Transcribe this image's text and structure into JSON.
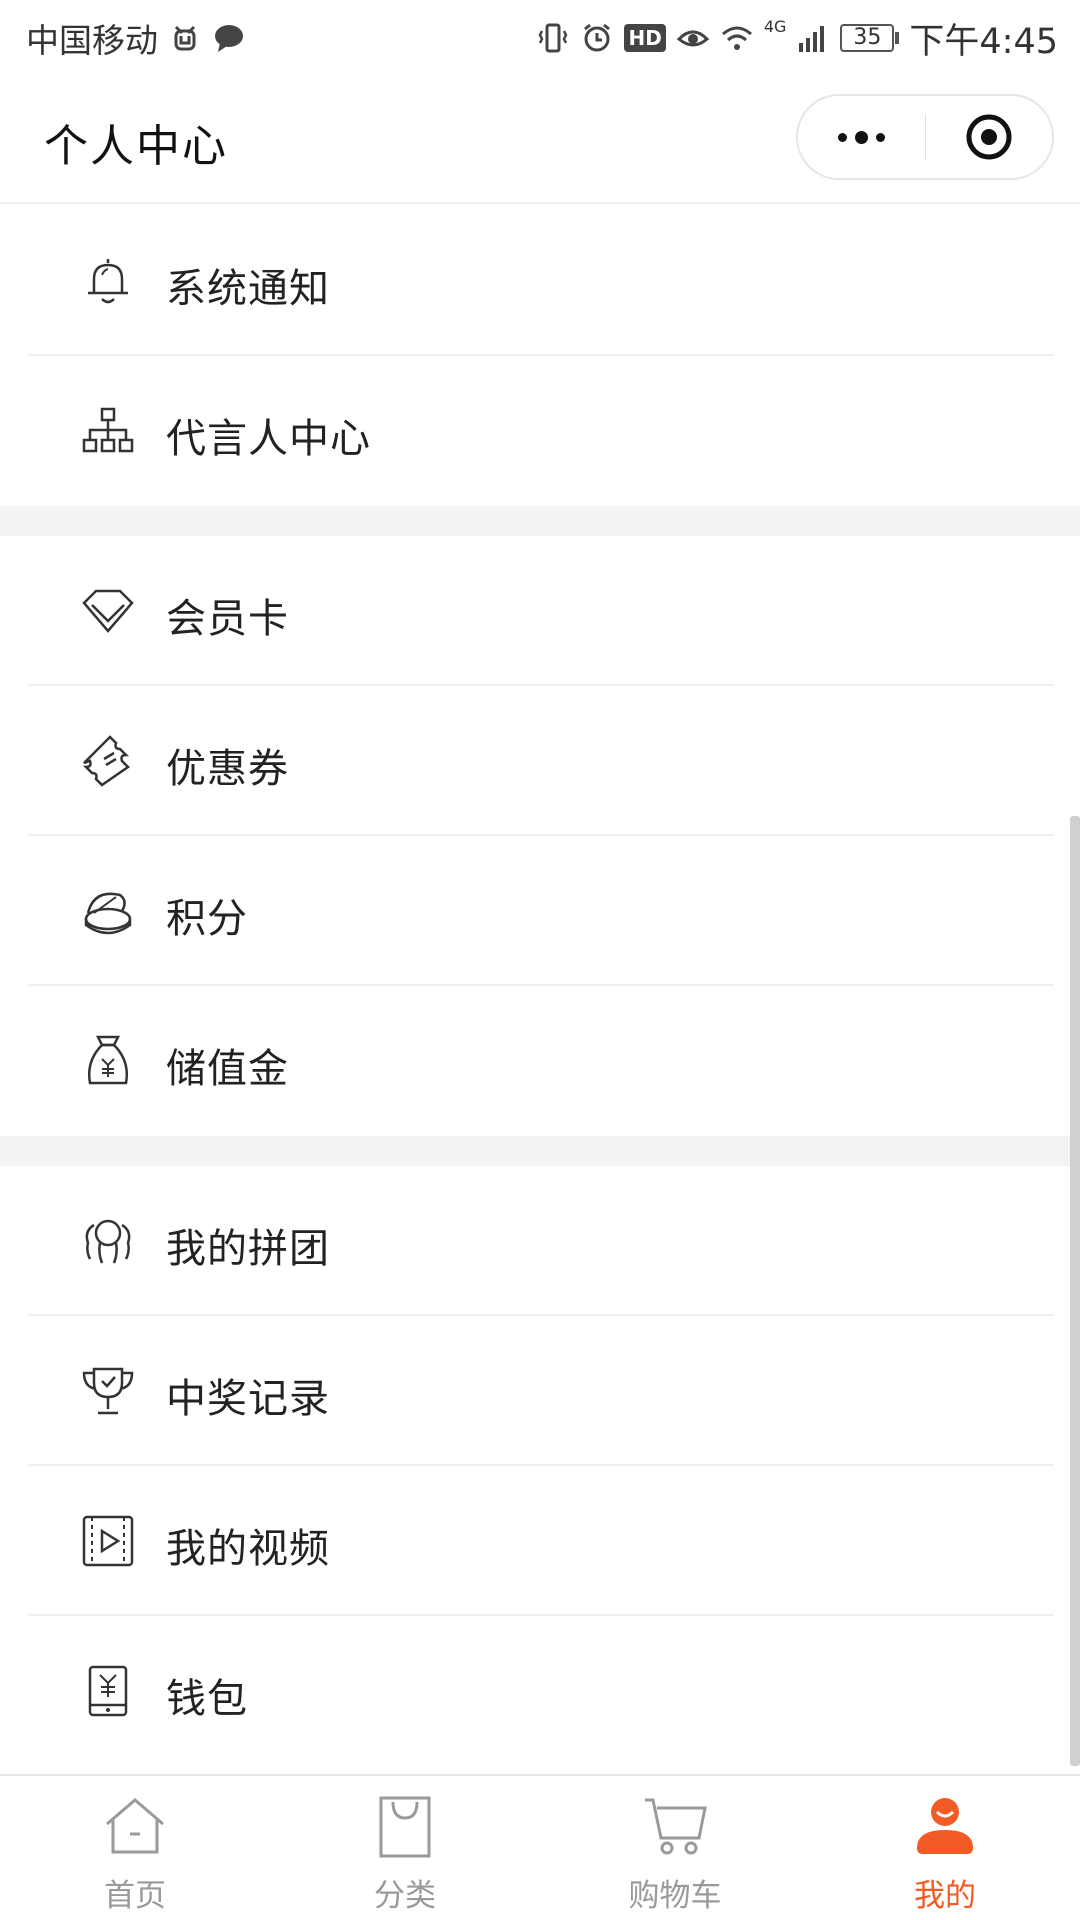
{
  "status_bar": {
    "carrier": "中国移动",
    "network": "4G",
    "battery": "35",
    "time": "下午4:45",
    "hd": "HD",
    "icons": [
      "alarm-clock-icon",
      "message-bubble-icon",
      "vibrate-icon",
      "alarm-icon",
      "eye-icon",
      "wifi-icon",
      "signal-icon",
      "battery-icon"
    ]
  },
  "header": {
    "title": "个人中心",
    "capsule": {
      "more_icon": "more-dots-icon",
      "close_icon": "target-icon"
    }
  },
  "groups": [
    {
      "items": [
        {
          "label": "系统通知",
          "icon": "bell-icon"
        },
        {
          "label": "代言人中心",
          "icon": "org-chart-icon"
        }
      ]
    },
    {
      "items": [
        {
          "label": "会员卡",
          "icon": "diamond-icon"
        },
        {
          "label": "优惠券",
          "icon": "ticket-icon"
        },
        {
          "label": "积分",
          "icon": "coins-icon"
        },
        {
          "label": "储值金",
          "icon": "money-bag-icon"
        }
      ]
    },
    {
      "items": [
        {
          "label": "我的拼团",
          "icon": "group-icon"
        },
        {
          "label": "中奖记录",
          "icon": "trophy-icon"
        },
        {
          "label": "我的视频",
          "icon": "video-icon"
        },
        {
          "label": "钱包",
          "icon": "wallet-icon"
        }
      ]
    }
  ],
  "tabbar": {
    "active_color": "#f25b25",
    "inactive_color": "#9a9a9a",
    "tabs": [
      {
        "label": "首页",
        "icon": "home-icon",
        "active": false
      },
      {
        "label": "分类",
        "icon": "bag-icon",
        "active": false
      },
      {
        "label": "购物车",
        "icon": "cart-icon",
        "active": false
      },
      {
        "label": "我的",
        "icon": "user-icon",
        "active": true
      }
    ]
  }
}
